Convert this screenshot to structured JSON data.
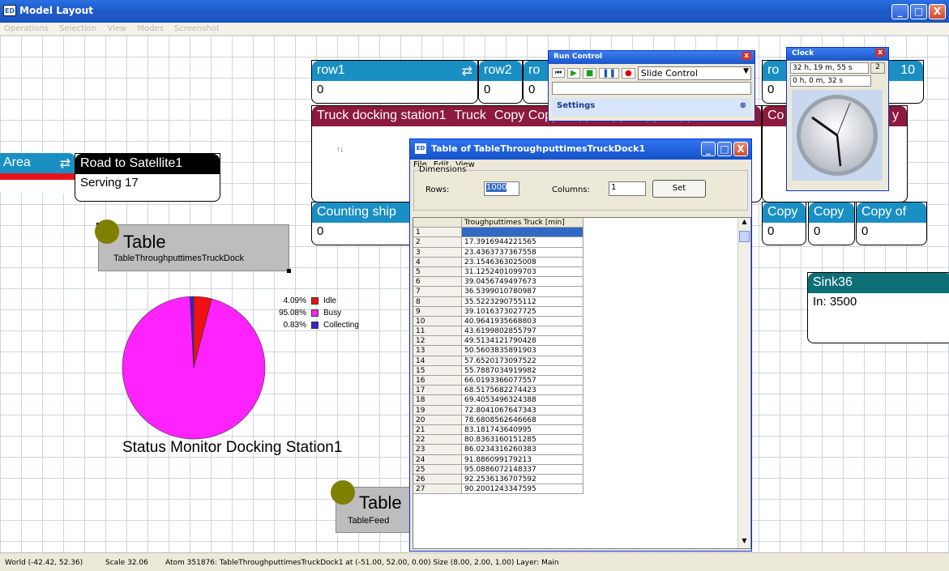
{
  "window": {
    "title": "Model Layout",
    "icon_text": "ED",
    "controls": [
      "_",
      "□",
      "X"
    ]
  },
  "menu": [
    "Operations",
    "Selection",
    "View",
    "Modes",
    "Screenshot"
  ],
  "nodes": {
    "row1": {
      "title": "row1",
      "value": "0"
    },
    "row2": {
      "title": "row2",
      "value": "0"
    },
    "row3": {
      "title": "ro",
      "value": "0"
    },
    "row_right": {
      "title": "ro",
      "value": "0"
    },
    "row10": {
      "title": "10",
      "value": ""
    },
    "truck_dock": {
      "title": "Truck docking station1",
      "title2": "Truck",
      "copies": "Copy   Copy   Copy   Copy   Copy   Copy",
      "mini": "↑↓"
    },
    "copy_right": {
      "title": "Co",
      "suffix": "y"
    },
    "area": {
      "title": "Area"
    },
    "road": {
      "title": "Road to Satellite1",
      "value": "Serving 17"
    },
    "counting": {
      "title": "Counting ship",
      "value": "0"
    },
    "copy1": {
      "title": "Copy",
      "value": "0"
    },
    "copy2": {
      "title": "Copy",
      "value": "0"
    },
    "copy3": {
      "title": "Copy of",
      "value": "0"
    },
    "sink": {
      "title": "Sink36",
      "value": "In: 3500"
    },
    "table1": {
      "title": "Table",
      "subtitle": "TableThroughputtimesTruckDock"
    },
    "table2": {
      "title": "Table",
      "subtitle": "TableFeed"
    }
  },
  "status_monitor": {
    "title": "Status Monitor Docking Station1"
  },
  "chart_data": {
    "type": "pie",
    "title": "Status Monitor Docking Station1",
    "slices": [
      {
        "label": "Idle",
        "pct_label": "4.09%",
        "value": 4.09,
        "color": "#ee1111"
      },
      {
        "label": "Busy",
        "pct_label": "95.08%",
        "value": 95.08,
        "color": "#ff22ff"
      },
      {
        "label": "Collecting",
        "pct_label": "0.83%",
        "value": 0.83,
        "color": "#3a22cc"
      }
    ],
    "legend": "right"
  },
  "run_control": {
    "title": "Run Control",
    "mode": "Slide Control",
    "settings": "Settings"
  },
  "clock": {
    "title": "Clock",
    "sim_time": "32 h, 19 m, 55 s",
    "real_time": "0 h, 0 m, 32 s",
    "button": "2"
  },
  "table_window": {
    "title": "Table of TableThroughputtimesTruckDock1",
    "menu": [
      "File",
      "Edit",
      "View"
    ],
    "group": "Dimensions",
    "rows_label": "Rows:",
    "rows_value": "1000",
    "cols_label": "Columns:",
    "cols_value": "1",
    "set_label": "Set",
    "column_header": "Troughputtimes Truck [min]",
    "rows": [
      {
        "n": "1",
        "v": ""
      },
      {
        "n": "2",
        "v": "17.3916944221565"
      },
      {
        "n": "3",
        "v": "23.4363737367558"
      },
      {
        "n": "4",
        "v": "23.1546363025008"
      },
      {
        "n": "5",
        "v": "31.1252401099703"
      },
      {
        "n": "6",
        "v": "39.0456749497673"
      },
      {
        "n": "7",
        "v": "36.5399010780987"
      },
      {
        "n": "8",
        "v": "35.5223290755112"
      },
      {
        "n": "9",
        "v": "39.1016373027725"
      },
      {
        "n": "10",
        "v": "40.9641935668803"
      },
      {
        "n": "11",
        "v": "43.6199802855797"
      },
      {
        "n": "12",
        "v": "49.5134121790428"
      },
      {
        "n": "13",
        "v": "50.5603835891903"
      },
      {
        "n": "14",
        "v": "57.6520173097522"
      },
      {
        "n": "15",
        "v": "55.7887034919982"
      },
      {
        "n": "16",
        "v": "66.0193366077557"
      },
      {
        "n": "17",
        "v": "68.5175682274423"
      },
      {
        "n": "18",
        "v": "69.4053496324388"
      },
      {
        "n": "19",
        "v": "72.8041067647343"
      },
      {
        "n": "20",
        "v": "78.6808562646668"
      },
      {
        "n": "21",
        "v": "83.181743640995"
      },
      {
        "n": "22",
        "v": "80.8363160151285"
      },
      {
        "n": "23",
        "v": "86.0234316260383"
      },
      {
        "n": "24",
        "v": "91.886099179213"
      },
      {
        "n": "25",
        "v": "95.0886072148337"
      },
      {
        "n": "26",
        "v": "92.2536136707592"
      },
      {
        "n": "27",
        "v": "90.2001243347595"
      }
    ]
  },
  "status": {
    "world": "World (-42.42, 52.36)",
    "scale": "Scale 32.06",
    "atom": "Atom 351876: TableThroughputtimesTruckDock1 at (-51.00, 52.00, 0.00) Size (8.00, 2.00, 1.00) Layer: Main"
  }
}
